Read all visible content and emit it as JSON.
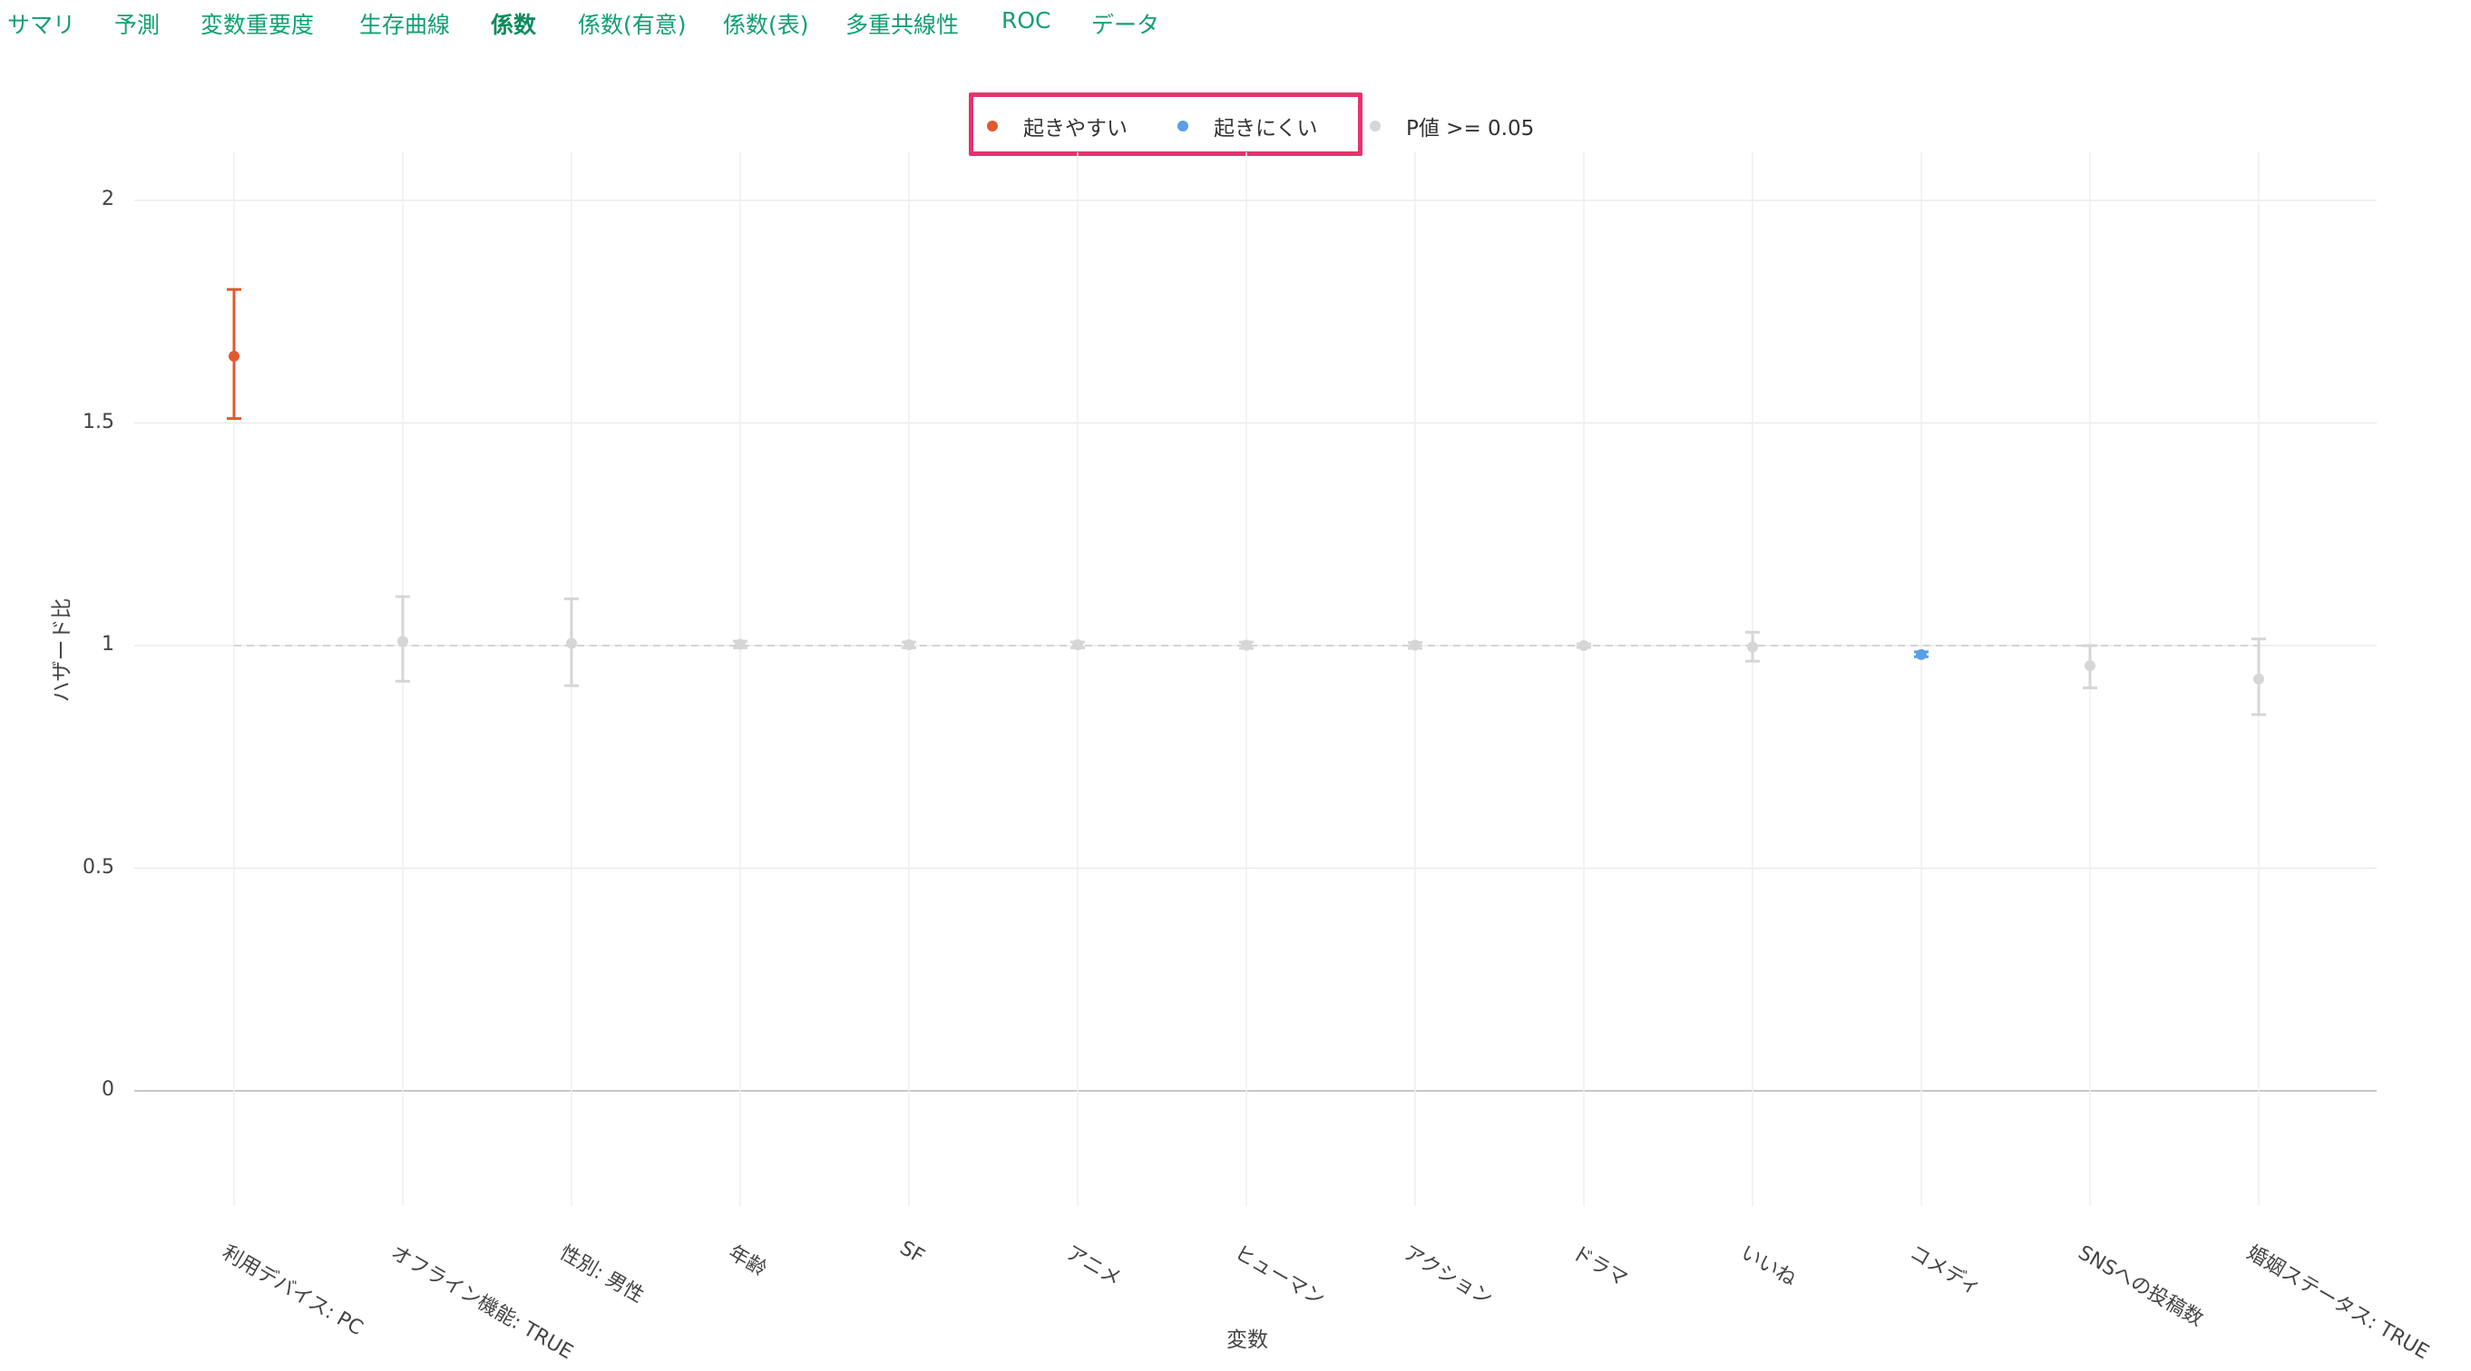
{
  "tabs": [
    {
      "label": "サマリ"
    },
    {
      "label": "予測"
    },
    {
      "label": "変数重要度"
    },
    {
      "label": "生存曲線"
    },
    {
      "label": "係数",
      "active": true
    },
    {
      "label": "係数(有意)"
    },
    {
      "label": "係数(表)"
    },
    {
      "label": "多重共線性"
    },
    {
      "label": "ROC"
    },
    {
      "label": "データ"
    }
  ],
  "colors": {
    "increase": "#e2582f",
    "decrease": "#5b9ee6",
    "not_significant": "#d6d6d6",
    "highlight": "#e8326c",
    "tab_text": "#12a06f"
  },
  "chart_data": {
    "type": "scatter",
    "subtype": "error-bar",
    "xlabel": "変数",
    "ylabel": "ハザード比",
    "ylim": [
      -0.27,
      2.1
    ],
    "yticks": [
      0,
      0.5,
      1,
      1.5,
      2
    ],
    "ytick_labels": [
      "0",
      "0.5",
      "1",
      "1.5",
      "2"
    ],
    "reference_line": 1,
    "grid": true,
    "legend_position": "top-center",
    "legend": [
      {
        "label": "起きやすい",
        "group": "increase"
      },
      {
        "label": "起きにくい",
        "group": "decrease"
      },
      {
        "label": "P値 >= 0.05",
        "group": "not_significant"
      }
    ],
    "categories": [
      "利用デバイス: PC",
      "オフライン機能: TRUE",
      "性別: 男性",
      "年齢",
      "SF",
      "アニメ",
      "ヒューマン",
      "アクション",
      "ドラマ",
      "いいね",
      "コメディ",
      "SNSへの投稿数",
      "婚姻ステータス: TRUE"
    ],
    "points": [
      {
        "label": "利用デバイス: PC",
        "estimate": 1.65,
        "lower": 1.51,
        "upper": 1.8,
        "group": "increase"
      },
      {
        "label": "オフライン機能: TRUE",
        "estimate": 1.01,
        "lower": 0.92,
        "upper": 1.11,
        "group": "not_significant"
      },
      {
        "label": "性別: 男性",
        "estimate": 1.005,
        "lower": 0.91,
        "upper": 1.105,
        "group": "not_significant"
      },
      {
        "label": "年齢",
        "estimate": 1.003,
        "lower": 0.995,
        "upper": 1.01,
        "group": "not_significant"
      },
      {
        "label": "SF",
        "estimate": 1.002,
        "lower": 0.995,
        "upper": 1.008,
        "group": "not_significant"
      },
      {
        "label": "アニメ",
        "estimate": 1.002,
        "lower": 0.995,
        "upper": 1.008,
        "group": "not_significant"
      },
      {
        "label": "ヒューマン",
        "estimate": 1.001,
        "lower": 0.994,
        "upper": 1.008,
        "group": "not_significant"
      },
      {
        "label": "アクション",
        "estimate": 1.001,
        "lower": 0.994,
        "upper": 1.007,
        "group": "not_significant"
      },
      {
        "label": "ドラマ",
        "estimate": 1.0,
        "lower": 0.996,
        "upper": 1.004,
        "group": "not_significant"
      },
      {
        "label": "いいね",
        "estimate": 0.997,
        "lower": 0.965,
        "upper": 1.03,
        "group": "not_significant"
      },
      {
        "label": "コメディ",
        "estimate": 0.98,
        "lower": 0.975,
        "upper": 0.986,
        "group": "decrease"
      },
      {
        "label": "SNSへの投稿数",
        "estimate": 0.955,
        "lower": 0.905,
        "upper": 1.0,
        "group": "not_significant"
      },
      {
        "label": "婚姻ステータス: TRUE",
        "estimate": 0.925,
        "lower": 0.845,
        "upper": 1.015,
        "group": "not_significant"
      }
    ]
  }
}
